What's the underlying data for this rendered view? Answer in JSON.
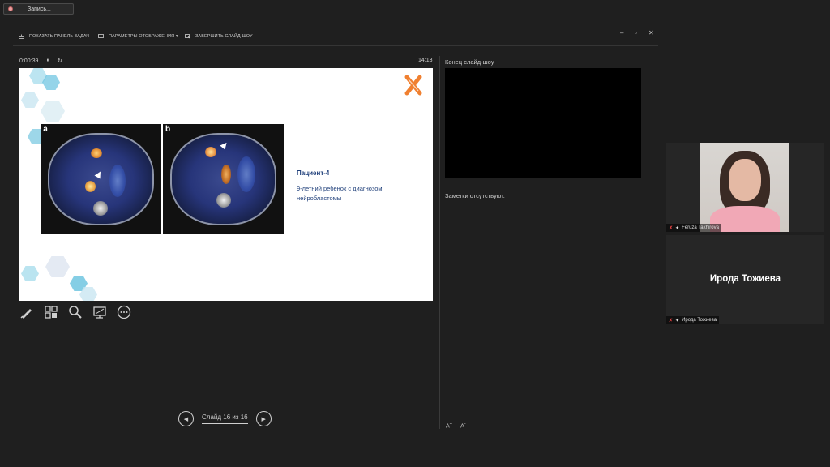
{
  "recording": {
    "label": "Запись..."
  },
  "toolbar": {
    "taskbar_label": "ПОКАЗАТЬ ПАНЕЛЬ ЗАДАЧ",
    "display_label": "ПАРАМЕТРЫ ОТОБРАЖЕНИЯ ▾",
    "end_label": "ЗАВЕРШИТЬ СЛАЙД-ШОУ"
  },
  "timer": {
    "elapsed": "0:00:39",
    "clock": "14:13"
  },
  "next_slide_label": "Конец слайд-шоу",
  "slide": {
    "title": "Пациент-4",
    "description": "9-летний ребенок с диагнозом нейробластомы",
    "image_labels": [
      "a",
      "b"
    ]
  },
  "tools": [
    "pen-icon",
    "grid-icon",
    "zoom-icon",
    "screen-icon",
    "more-icon"
  ],
  "navigation": {
    "label": "Слайд 16 из 16"
  },
  "notes": {
    "text": "Заметки отсутствуют."
  },
  "font_controls": {
    "increase": "A",
    "decrease": "A"
  },
  "participants": [
    {
      "name": "Feruza Takhirova",
      "has_video": true
    },
    {
      "name": "Ирода Тожиева",
      "display_name": "Ирода Тожиева",
      "has_video": false
    }
  ],
  "colors": {
    "accent_blue": "#1f3f7a",
    "background": "#1f1f1f",
    "mic_muted": "#e04040"
  }
}
